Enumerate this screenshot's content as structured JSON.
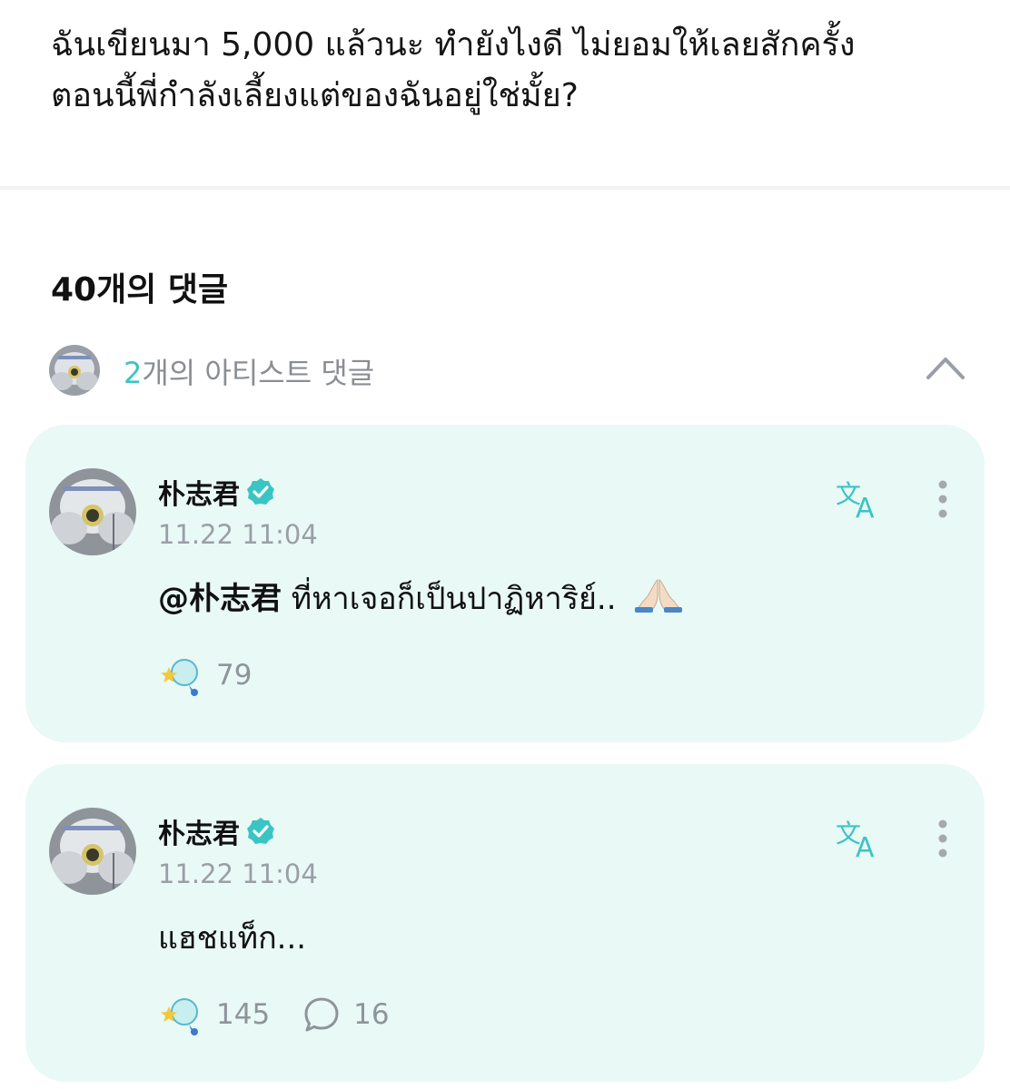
{
  "post": {
    "line1": "ฉันเขียนมา 5,000 แล้วนะ ทำยังไงดี ไม่ยอมให้เลยสักครั้ง",
    "line2": "ตอนนี้พี่กำลังเลี้ยงแต่ของฉันอยู่ใช่มั้ย?"
  },
  "comments_header": {
    "title": "40개의 댓글"
  },
  "artist_comments": {
    "count": "2",
    "label_suffix": "개의 아티스트 댓글",
    "toggle_icon": "chevron-up-icon"
  },
  "comments": [
    {
      "author": "朴志君",
      "verified_icon": "verified-badge-icon",
      "timestamp": "11.22 11:04",
      "mention": "@朴志君",
      "text": " ที่หาเจอก็เป็นปาฏิหาริย์.. ",
      "emoji": "folded-hands-emoji",
      "cheer_count": "79",
      "reply_count": null,
      "translate_icon": "translate-icon",
      "more_icon": "more-vertical-icon"
    },
    {
      "author": "朴志君",
      "verified_icon": "verified-badge-icon",
      "timestamp": "11.22 11:04",
      "mention": null,
      "text": "แฮชแท็ก...",
      "emoji": null,
      "cheer_count": "145",
      "reply_count": "16",
      "translate_icon": "translate-icon",
      "more_icon": "more-vertical-icon"
    }
  ],
  "colors": {
    "accent": "#3bc4c4",
    "card_background": "#e9f9f6",
    "muted_text": "#8f949a"
  }
}
